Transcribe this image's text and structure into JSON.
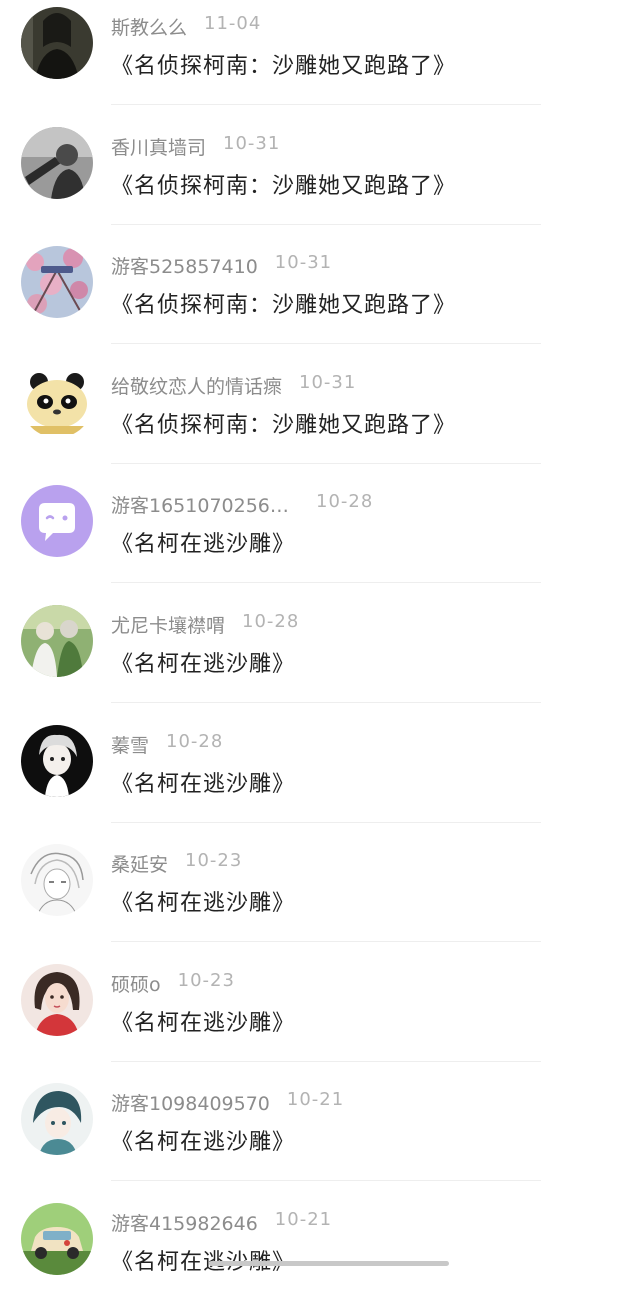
{
  "comments": [
    {
      "username": "斯教么么",
      "date": "11-04",
      "text": "《名侦探柯南：沙雕她又跑路了》",
      "avatar": "dark-portrait-avatar"
    },
    {
      "username": "香川真墙司",
      "date": "10-31",
      "text": "《名侦探柯南：沙雕她又跑路了》",
      "avatar": "grayscale-person-avatar"
    },
    {
      "username": "游客525857410",
      "date": "10-31",
      "text": "《名侦探柯南：沙雕她又跑路了》",
      "avatar": "cherry-blossom-avatar"
    },
    {
      "username": "给敬纹恋人的情话瘝",
      "date": "10-31",
      "text": "《名侦探柯南：沙雕她又跑路了》",
      "avatar": "panda-plush-avatar"
    },
    {
      "username": "游客1651070256…",
      "date": "10-28",
      "text": "《名柯在逃沙雕》",
      "avatar": "default-chat-bubble-avatar"
    },
    {
      "username": "尤尼卡壤襟喟",
      "date": "10-28",
      "text": "《名柯在逃沙雕》",
      "avatar": "anime-group-avatar"
    },
    {
      "username": "蓁雪",
      "date": "10-28",
      "text": "《名柯在逃沙雕》",
      "avatar": "anime-girl-black-avatar"
    },
    {
      "username": "桑延安",
      "date": "10-23",
      "text": "《名柯在逃沙雕》",
      "avatar": "anime-sketch-avatar"
    },
    {
      "username": "硕硕o",
      "date": "10-23",
      "text": "《名柯在逃沙雕》",
      "avatar": "girl-red-dress-avatar"
    },
    {
      "username": "游客1098409570",
      "date": "10-21",
      "text": "《名柯在逃沙雕》",
      "avatar": "anime-boy-teal-avatar"
    },
    {
      "username": "游客415982646",
      "date": "10-21",
      "text": "《名柯在逃沙雕》",
      "avatar": "toy-car-avatar"
    }
  ]
}
